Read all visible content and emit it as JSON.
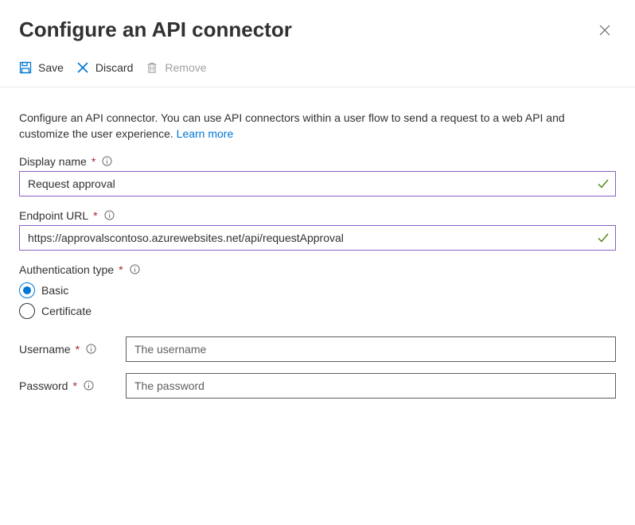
{
  "header": {
    "title": "Configure an API connector"
  },
  "toolbar": {
    "save_label": "Save",
    "discard_label": "Discard",
    "remove_label": "Remove"
  },
  "description": {
    "text": "Configure an API connector. You can use API connectors within a user flow to send a request to a web API and customize the user experience.",
    "learn_more": "Learn more"
  },
  "fields": {
    "display_name": {
      "label": "Display name",
      "value": "Request approval"
    },
    "endpoint_url": {
      "label": "Endpoint URL",
      "value": "https://approvalscontoso.azurewebsites.net/api/requestApproval"
    },
    "auth_type": {
      "label": "Authentication type",
      "options": {
        "basic": "Basic",
        "certificate": "Certificate"
      },
      "selected": "basic"
    },
    "username": {
      "label": "Username",
      "placeholder": "The username"
    },
    "password": {
      "label": "Password",
      "placeholder": "The password"
    }
  }
}
